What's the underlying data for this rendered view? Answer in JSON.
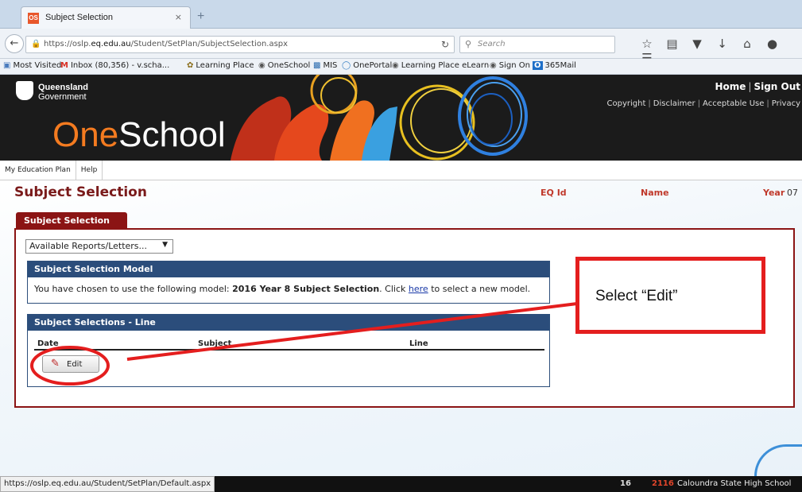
{
  "browser": {
    "tab_title": "Subject Selection",
    "tab_favicon": "OS",
    "tab_close": "×",
    "new_tab": "+",
    "url_prefix": "https://oslp.",
    "url_domain": "eq.edu.au",
    "url_path": "/Student/SetPlan/SubjectSelection.aspx",
    "search_placeholder": "Search",
    "bookmarks": [
      {
        "label": "Most Visited",
        "icon": "most-visited-icon"
      },
      {
        "label": "Inbox (80,356) - v.scha...",
        "icon": "gmail-icon"
      },
      {
        "label": "Learning Place",
        "icon": "learning-place-icon"
      },
      {
        "label": "OneSchool",
        "icon": "oneschool-icon"
      },
      {
        "label": "MIS",
        "icon": "mis-icon"
      },
      {
        "label": "OnePortal",
        "icon": "oneportal-icon"
      },
      {
        "label": "Learning Place eLearn",
        "icon": "elearn-icon"
      },
      {
        "label": "Sign On",
        "icon": "sign-on-icon"
      },
      {
        "label": "365Mail",
        "icon": "outlook-icon"
      }
    ]
  },
  "header": {
    "gov_line1": "Queensland",
    "gov_line2": "Government",
    "brand_one": "One",
    "brand_school": "School",
    "home": "Home",
    "sign_out": "Sign Out",
    "links": [
      "Copyright",
      "Disclaimer",
      "Acceptable Use",
      "Privacy"
    ]
  },
  "menu": [
    "My Education Plan",
    "Help"
  ],
  "page": {
    "title": "Subject Selection",
    "eq_id_label": "EQ Id",
    "name_label": "Name",
    "year_label": "Year",
    "year_value": "07",
    "tab": "Subject Selection",
    "reports_dropdown": "Available Reports/Letters...",
    "model_panel_title": "Subject Selection Model",
    "model_text_prefix": "You have chosen to use the following model:",
    "model_name": "2016 Year 8 Subject Selection",
    "model_text_click": ". Click",
    "model_link": "here",
    "model_text_suffix": "to select a new model.",
    "lines_panel_title": "Subject Selections - Line",
    "columns": [
      "Date",
      "Subject",
      "Line"
    ],
    "edit_button": "Edit"
  },
  "callout": {
    "text": "Select “Edit”",
    "color": "#e41e1e"
  },
  "status": {
    "url": "https://oslp.eq.edu.au/Student/SetPlan/Default.aspx",
    "num": "16",
    "code": "2116",
    "school": "Caloundra State High School"
  },
  "colors": {
    "maroon": "#8b1414",
    "panel_blue": "#2b4d7b",
    "brand_orange": "#f47b20"
  }
}
